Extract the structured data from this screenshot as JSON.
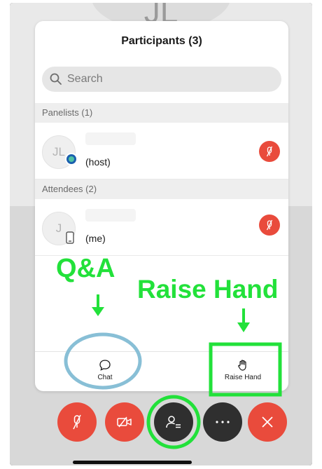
{
  "panel": {
    "title": "Participants (3)",
    "search_placeholder": "Search"
  },
  "sections": {
    "panelists_label": "Panelists (1)",
    "attendees_label": "Attendees (2)"
  },
  "participants": [
    {
      "initials": "JL",
      "role": "(host)"
    },
    {
      "initials": "J",
      "role": "(me)"
    }
  ],
  "tabs": {
    "chat_label": "Chat",
    "raise_hand_label": "Raise Hand"
  },
  "annotations": {
    "qa_label": "Q&A",
    "raise_hand_label": "Raise Hand"
  },
  "background": {
    "avatar_initials": "JL"
  },
  "colors": {
    "accent_green": "#22e13a",
    "circle_blue": "#88bfd6",
    "mute_red": "#e94b3c",
    "dark_button": "#2f2f2f"
  },
  "icons": {
    "mic": "mic-muted-icon",
    "video": "video-off-icon",
    "participants": "participants-icon",
    "more": "more-icon",
    "leave": "close-icon",
    "chat": "chat-bubble-icon",
    "raise_hand": "hand-icon"
  }
}
